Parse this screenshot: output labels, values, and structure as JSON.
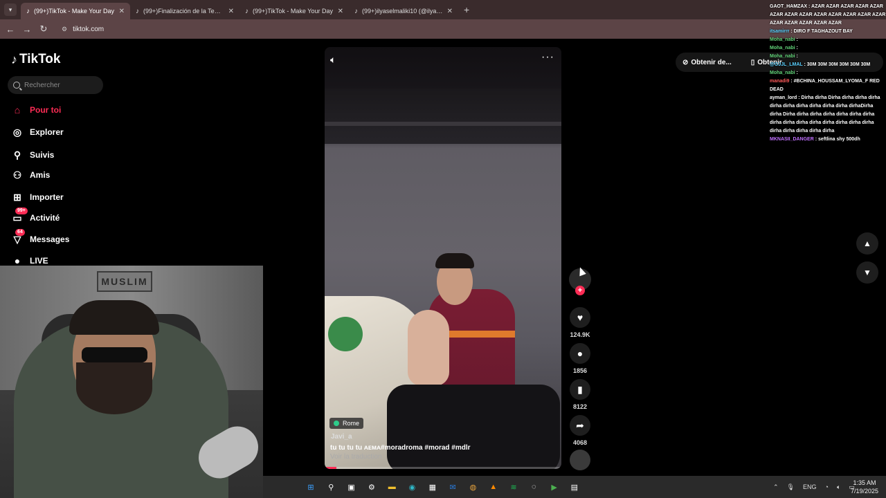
{
  "browser": {
    "tab_dropdown_icon": "chevron-down-icon",
    "tabs": [
      {
        "label": "(99+)TikTok - Make Your Day",
        "active": true
      },
      {
        "label": "(99+)Finalización de la Temporada",
        "active": false
      },
      {
        "label": "(99+)TikTok - Make Your Day",
        "active": false
      },
      {
        "label": "(99+)ilyaselmaliki10 (@ilyaselmaliki10)",
        "active": false
      }
    ],
    "new_tab_icon": "plus-icon",
    "url": "tiktok.com"
  },
  "tiktok": {
    "logo_text": "TikTok",
    "search_placeholder": "Rechercher",
    "nav": [
      {
        "label": "Pour toi",
        "icon": "home-icon",
        "active": true
      },
      {
        "label": "Explorer",
        "icon": "compass-icon"
      },
      {
        "label": "Suivis",
        "icon": "following-icon"
      },
      {
        "label": "Amis",
        "icon": "friends-icon"
      },
      {
        "label": "Importer",
        "icon": "upload-icon"
      },
      {
        "label": "Activité",
        "icon": "activity-icon",
        "badge": "99+"
      },
      {
        "label": "Messages",
        "icon": "messages-icon",
        "badge": "64"
      },
      {
        "label": "LIVE",
        "icon": "live-icon"
      }
    ],
    "top_right": {
      "get_app_label": "Obtenir de...",
      "get_app2_label": "Obtenir"
    }
  },
  "video": {
    "location": "Rome",
    "author": "Javi_a",
    "caption": "tu tu tu tu ᴀᴇᴍᴀ#moradroma  #morad  #mdlr",
    "translate_label": "Voir la traduction",
    "progress": 0.05,
    "likes": "124.9K",
    "comments": "1856",
    "saves": "8122",
    "shares": "4068"
  },
  "chat": [
    {
      "user": "GAOT_HAMZAX",
      "text": "AZAR AZAR AZAR AZAR AZAR AZAR AZAR AZAR AZAR AZAR AZAR AZAR AZAR AZAR AZAR AZAR AZAR AZAR"
    },
    {
      "user": "itsamirrr",
      "text": "DIRO F TAGHAZOUT BAY"
    },
    {
      "user": "Moha_nabi",
      "text": ""
    },
    {
      "user": "Moha_nabi",
      "text": ""
    },
    {
      "user": "Moha_nabi",
      "text": ""
    },
    {
      "user": "@OJJL_LMAL",
      "text": "30M 30M 30M 30M 30M 30M"
    },
    {
      "user": "Moha_nabi",
      "text": ""
    },
    {
      "user": "manadi9",
      "text": "#BCHINA_HOUSSAM_LYOMA_F RED DEAD"
    },
    {
      "user": "ayman_lord",
      "text": "Dirha dirha Dirha dirha dirha dirha dirha dirha dirha dirha dirha dirha dirhaDirha dirha Dirha dirha dirha dirha dirha dirha dirha dirha dirha dirha dirha dirha dirha dirha dirha dirha dirha dirha dirha dirha"
    },
    {
      "user": "MKNASII_DANGER",
      "text": "seftlina shy 500dh"
    }
  ],
  "taskbar": {
    "icons": [
      "windows-start-icon",
      "search-icon",
      "task-view-icon",
      "settings-icon",
      "file-explorer-icon",
      "edge-icon",
      "store-icon",
      "outlook-icon",
      "chrome-icon",
      "vlc-icon",
      "spotify-icon",
      "steam-icon",
      "obs-icon",
      "calculator-icon"
    ],
    "lang": "ENG",
    "time": "1:35 AM",
    "date": "7/19/2025"
  },
  "colors": {
    "brand": "#fe2c55",
    "chrome_tabbar": "#3a2b2c",
    "chrome_toolbar": "#5c4446"
  }
}
